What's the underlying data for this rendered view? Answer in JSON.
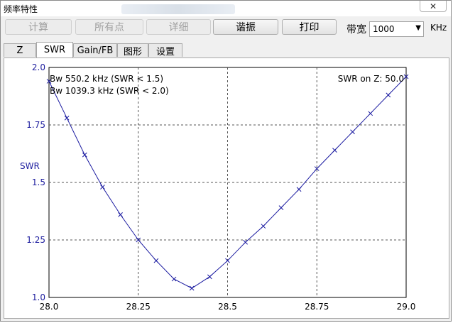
{
  "window": {
    "title": "频率特性",
    "close_glyph": "✕"
  },
  "toolbar": {
    "buttons": [
      {
        "label": "计算",
        "enabled": false
      },
      {
        "label": "所有点",
        "enabled": false
      },
      {
        "label": "详细",
        "enabled": false
      },
      {
        "label": "谐振",
        "enabled": true
      },
      {
        "label": "打印",
        "enabled": true
      }
    ],
    "bandwidth_label": "带宽",
    "bandwidth_value": "1000",
    "bandwidth_unit": "KHz"
  },
  "tabs": [
    {
      "label": "Z",
      "active": false
    },
    {
      "label": "SWR",
      "active": true
    },
    {
      "label": "Gain/FB",
      "active": false
    },
    {
      "label": "图形",
      "active": false
    },
    {
      "label": "设置",
      "active": false
    }
  ],
  "colors": {
    "curve": "#1a1aa0",
    "axis_text": "#2020a0",
    "grid": "#555555"
  },
  "chart_data": {
    "type": "line",
    "ylabel": "SWR",
    "xlabel": "",
    "xlim": [
      28.0,
      29.0
    ],
    "ylim": [
      1.0,
      2.0
    ],
    "x_ticks": [
      "28.0",
      "28.25",
      "28.5",
      "28.75",
      "29.0"
    ],
    "y_ticks": [
      "1.0",
      "1.25",
      "1.5",
      "1.75",
      "2.0"
    ],
    "grid": true,
    "annotations": {
      "bw1": "Bw 550.2 kHz (SWR < 1.5)",
      "bw2": "Bw 1039.3 kHz (SWR < 2.0)",
      "z_ref": "SWR on Z: 50.0"
    },
    "series": [
      {
        "x": [
          28.0,
          28.05,
          28.1,
          28.15,
          28.2,
          28.25,
          28.3,
          28.35,
          28.4,
          28.45,
          28.5,
          28.55,
          28.6,
          28.65,
          28.7,
          28.75,
          28.8,
          28.85,
          28.9,
          28.95,
          29.0
        ],
        "y": [
          1.94,
          1.78,
          1.62,
          1.48,
          1.36,
          1.25,
          1.16,
          1.08,
          1.04,
          1.09,
          1.16,
          1.24,
          1.31,
          1.39,
          1.47,
          1.56,
          1.64,
          1.72,
          1.8,
          1.88,
          1.96
        ]
      }
    ]
  }
}
